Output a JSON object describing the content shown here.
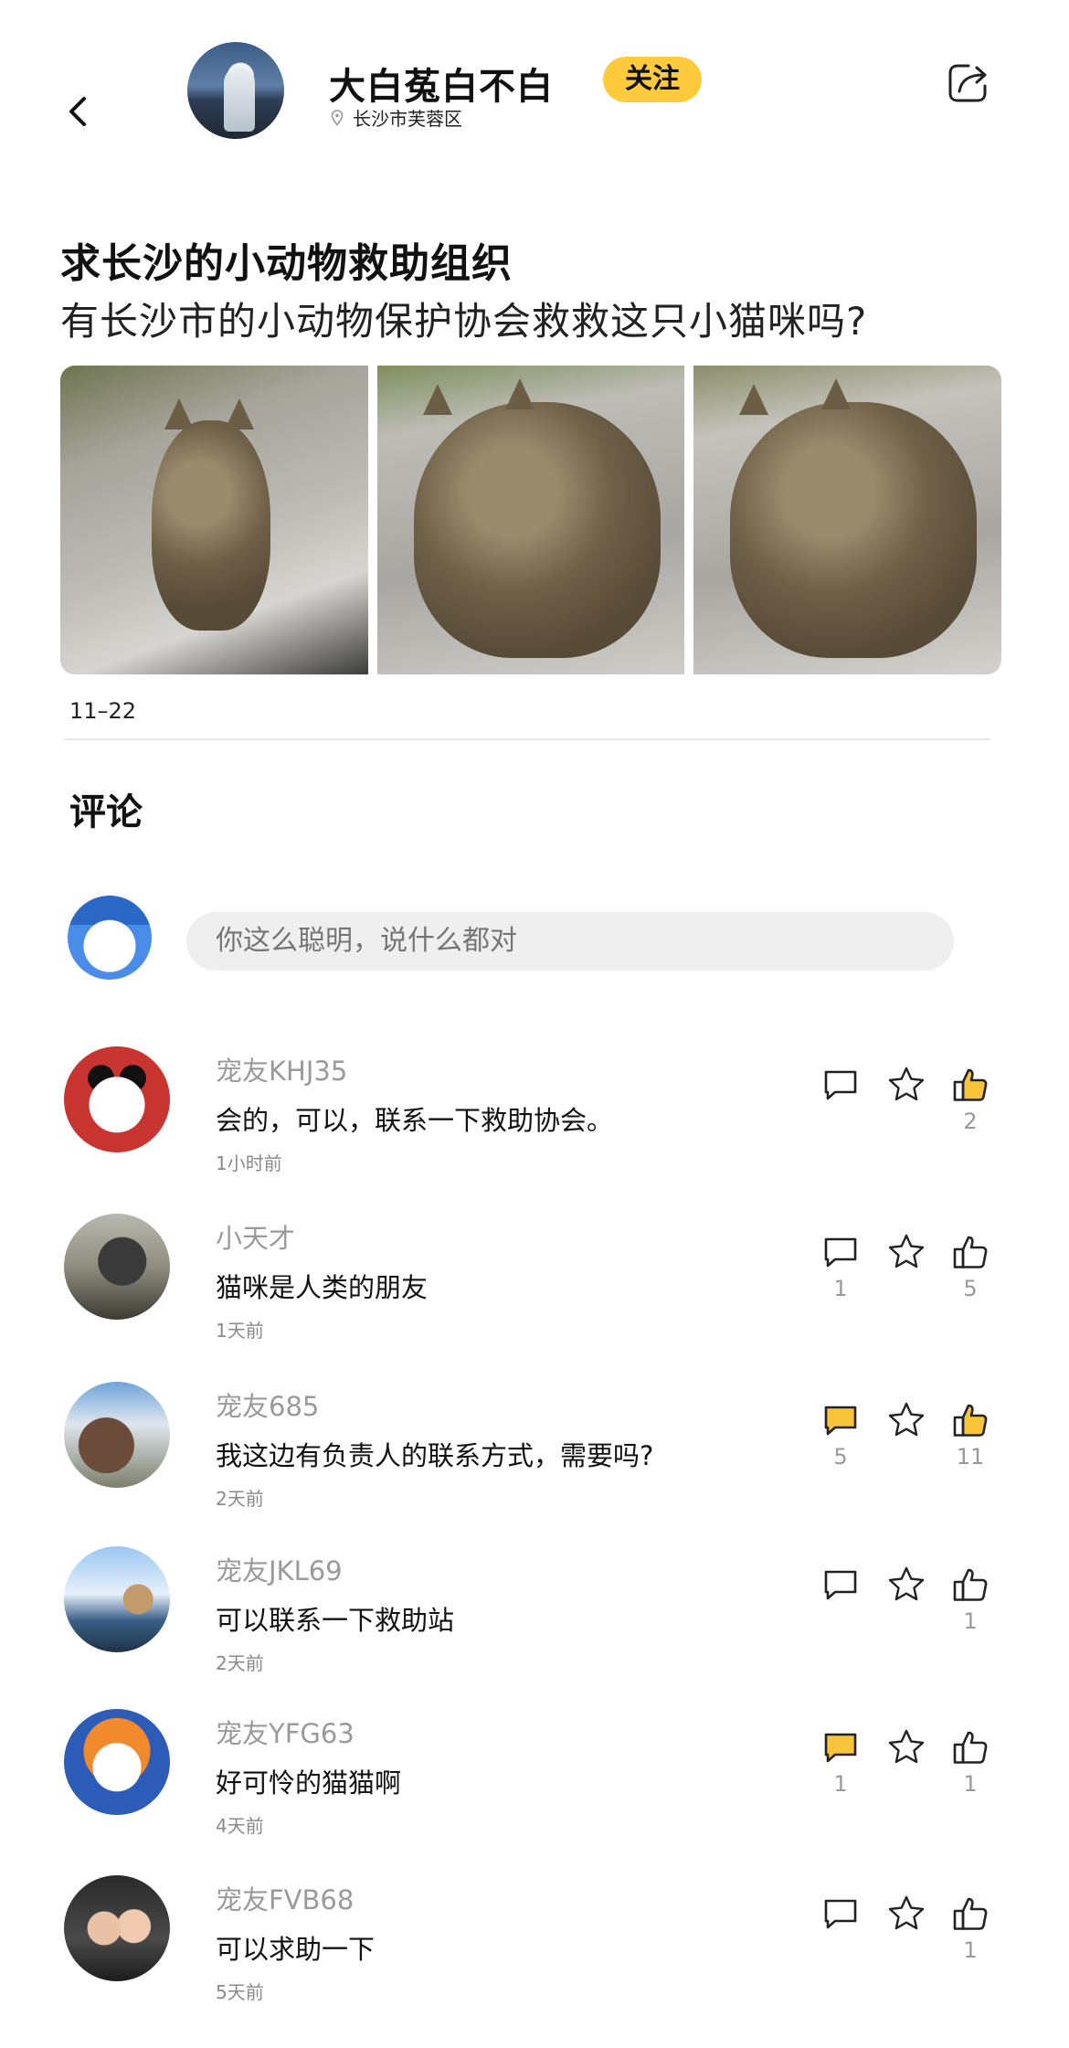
{
  "author": {
    "name": "大白菟白不白",
    "location": "长沙市芙蓉区",
    "follow_label": "关注"
  },
  "post": {
    "title": "求长沙的小动物救助组织",
    "body": "有长沙市的小动物保护协会救救这只小猫咪吗?",
    "date": "11–22"
  },
  "comments_section": {
    "heading": "评论",
    "input_placeholder": "你这么聪明，说什么都对"
  },
  "colors": {
    "accent": "#ffcb3d",
    "icon_active_fill": "#f7c43a",
    "icon_stroke": "#222222"
  },
  "comments": [
    {
      "user": "宠友KHJ35",
      "text": "会的，可以，联系一下救助协会。",
      "time": "1小时前",
      "reply_count": "",
      "like_count": "2",
      "reply_active": false,
      "like_active": true
    },
    {
      "user": "小天才",
      "text": "猫咪是人类的朋友",
      "time": "1天前",
      "reply_count": "1",
      "like_count": "5",
      "reply_active": false,
      "like_active": false
    },
    {
      "user": "宠友685",
      "text": "我这边有负责人的联系方式，需要吗?",
      "time": "2天前",
      "reply_count": "5",
      "like_count": "11",
      "reply_active": true,
      "like_active": true
    },
    {
      "user": "宠友JKL69",
      "text": "可以联系一下救助站",
      "time": "2天前",
      "reply_count": "",
      "like_count": "1",
      "reply_active": false,
      "like_active": false
    },
    {
      "user": "宠友YFG63",
      "text": "好可怜的猫猫啊",
      "time": "4天前",
      "reply_count": "1",
      "like_count": "1",
      "reply_active": true,
      "like_active": false
    },
    {
      "user": "宠友FVB68",
      "text": "可以求助一下",
      "time": "5天前",
      "reply_count": "",
      "like_count": "1",
      "reply_active": false,
      "like_active": false
    }
  ]
}
